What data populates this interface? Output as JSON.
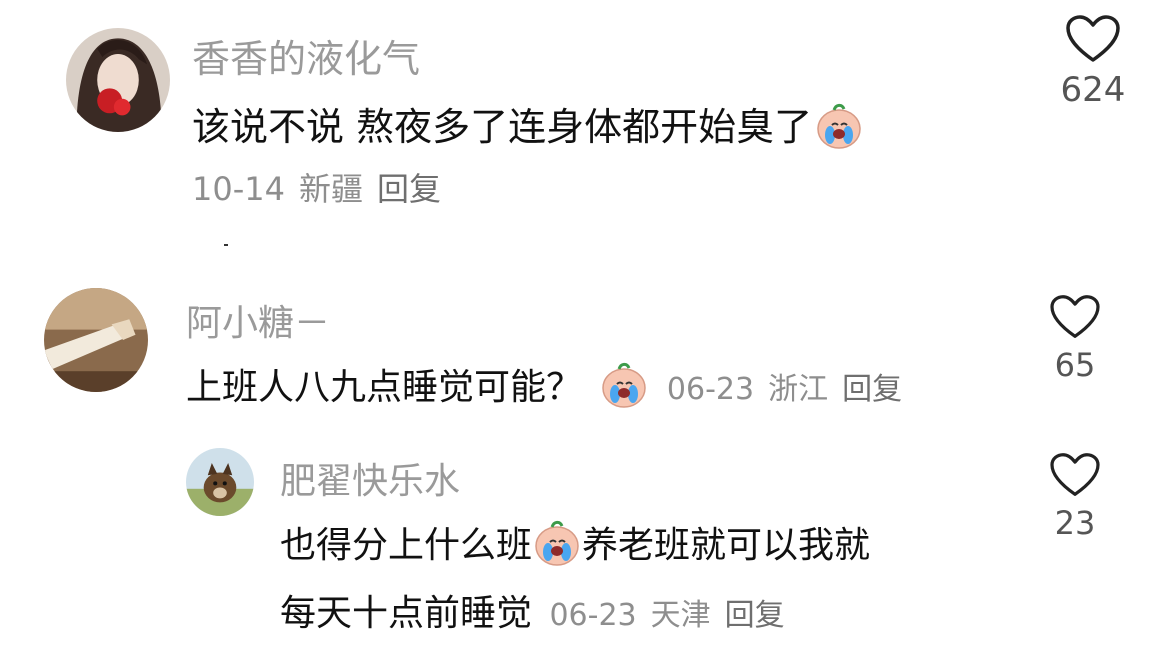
{
  "comments": [
    {
      "username": "香香的液化气",
      "text": "该说不说 熬夜多了连身体都开始臭了",
      "emoji": "crying-face",
      "date": "10-14",
      "location": "新疆",
      "reply_label": "回复",
      "likes": "624"
    },
    {
      "username": "阿小糖－",
      "text": "上班人八九点睡觉可能？",
      "emoji": "crying-face",
      "date": "06-23",
      "location": "浙江",
      "reply_label": "回复",
      "likes": "65"
    },
    {
      "username": "肥翟快乐水",
      "text_part1": "也得分上什么班",
      "emoji": "crying-face",
      "text_part2": "养老班就可以我就",
      "text_line2": "每天十点前睡觉",
      "date": "06-23",
      "location": "天津",
      "reply_label": "回复",
      "likes": "23"
    }
  ],
  "colors": {
    "username": "#9a9a9a",
    "text": "#111111",
    "meta": "#8e8e8e",
    "heart": "#222222"
  }
}
